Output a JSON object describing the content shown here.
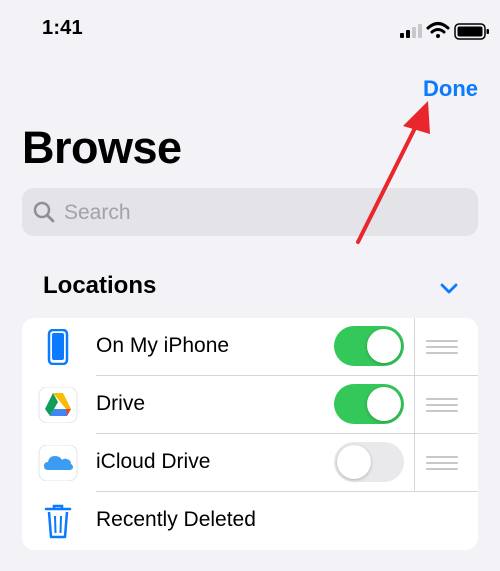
{
  "status_bar": {
    "time": "1:41"
  },
  "header": {
    "done_label": "Done",
    "title": "Browse"
  },
  "search": {
    "placeholder": "Search"
  },
  "locations": {
    "section_title": "Locations",
    "items": [
      {
        "label": "On My iPhone",
        "icon": "iphone-icon",
        "enabled": true
      },
      {
        "label": "Drive",
        "icon": "google-drive-icon",
        "enabled": true
      },
      {
        "label": "iCloud Drive",
        "icon": "icloud-icon",
        "enabled": false
      },
      {
        "label": "Recently Deleted",
        "icon": "trash-icon"
      }
    ]
  },
  "colors": {
    "accent": "#0a7aff",
    "toggle_on": "#34c759",
    "annotation_arrow": "#e8262c",
    "background": "#f2f2f7"
  }
}
